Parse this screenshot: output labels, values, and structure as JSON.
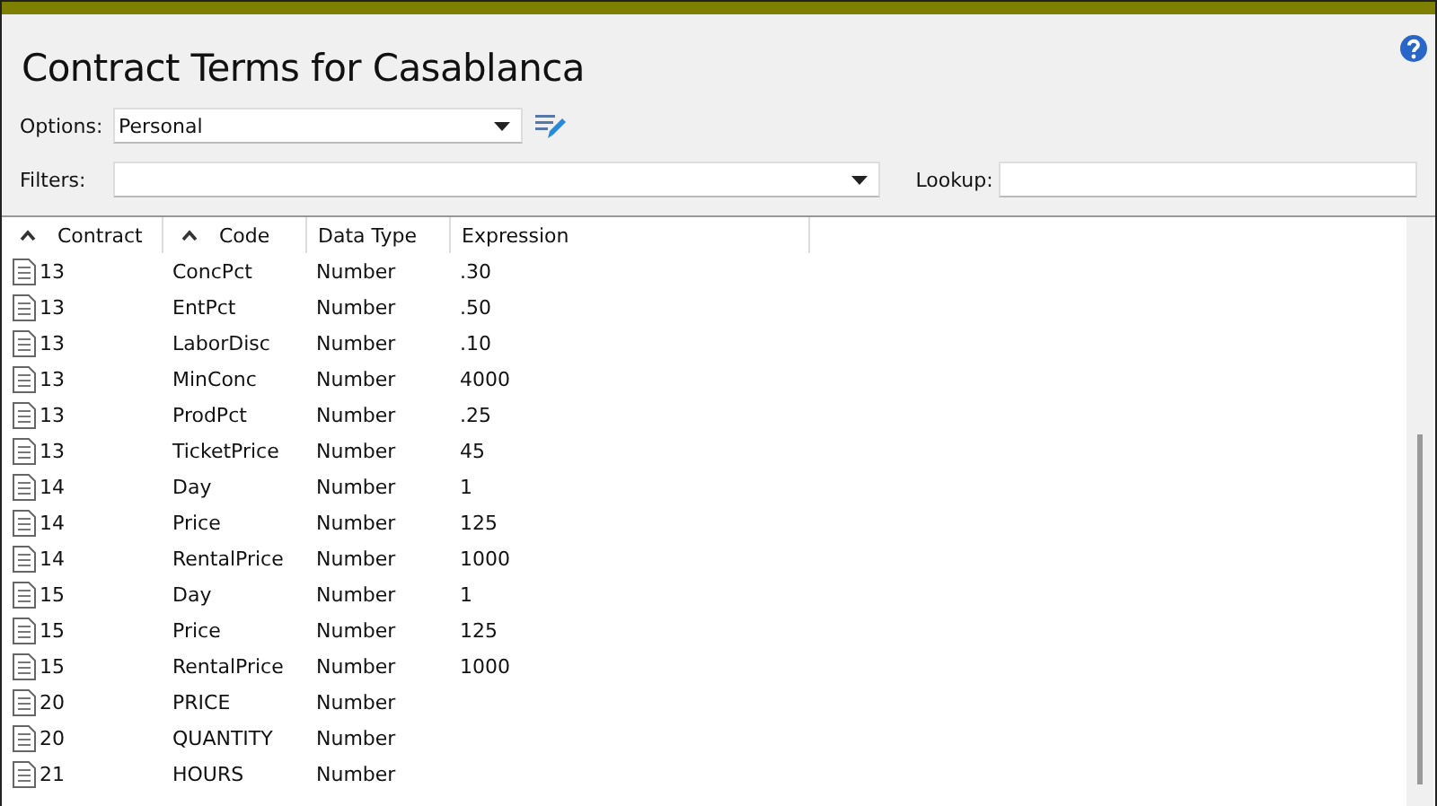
{
  "window": {
    "title": "Contract Terms for Casablanca"
  },
  "options": {
    "label": "Options:",
    "value": "Personal"
  },
  "filters": {
    "label": "Filters:"
  },
  "lookup": {
    "label": "Lookup:"
  },
  "table": {
    "columns": [
      {
        "label": "Contract",
        "sorted": true
      },
      {
        "label": "Code",
        "sorted": true
      },
      {
        "label": "Data Type",
        "sorted": false
      },
      {
        "label": "Expression",
        "sorted": false
      }
    ],
    "rows": [
      [
        "13",
        "ConcPct",
        "Number",
        ".30"
      ],
      [
        "13",
        "EntPct",
        "Number",
        ".50"
      ],
      [
        "13",
        "LaborDisc",
        "Number",
        ".10"
      ],
      [
        "13",
        "MinConc",
        "Number",
        "4000"
      ],
      [
        "13",
        "ProdPct",
        "Number",
        ".25"
      ],
      [
        "13",
        "TicketPrice",
        "Number",
        "45"
      ],
      [
        "14",
        "Day",
        "Number",
        "1"
      ],
      [
        "14",
        "Price",
        "Number",
        "125"
      ],
      [
        "14",
        "RentalPrice",
        "Number",
        "1000"
      ],
      [
        "15",
        "Day",
        "Number",
        "1"
      ],
      [
        "15",
        "Price",
        "Number",
        "125"
      ],
      [
        "15",
        "RentalPrice",
        "Number",
        "1000"
      ],
      [
        "20",
        "PRICE",
        "Number",
        ""
      ],
      [
        "20",
        "QUANTITY",
        "Number",
        ""
      ],
      [
        "21",
        "HOURS",
        "Number",
        ""
      ]
    ]
  }
}
